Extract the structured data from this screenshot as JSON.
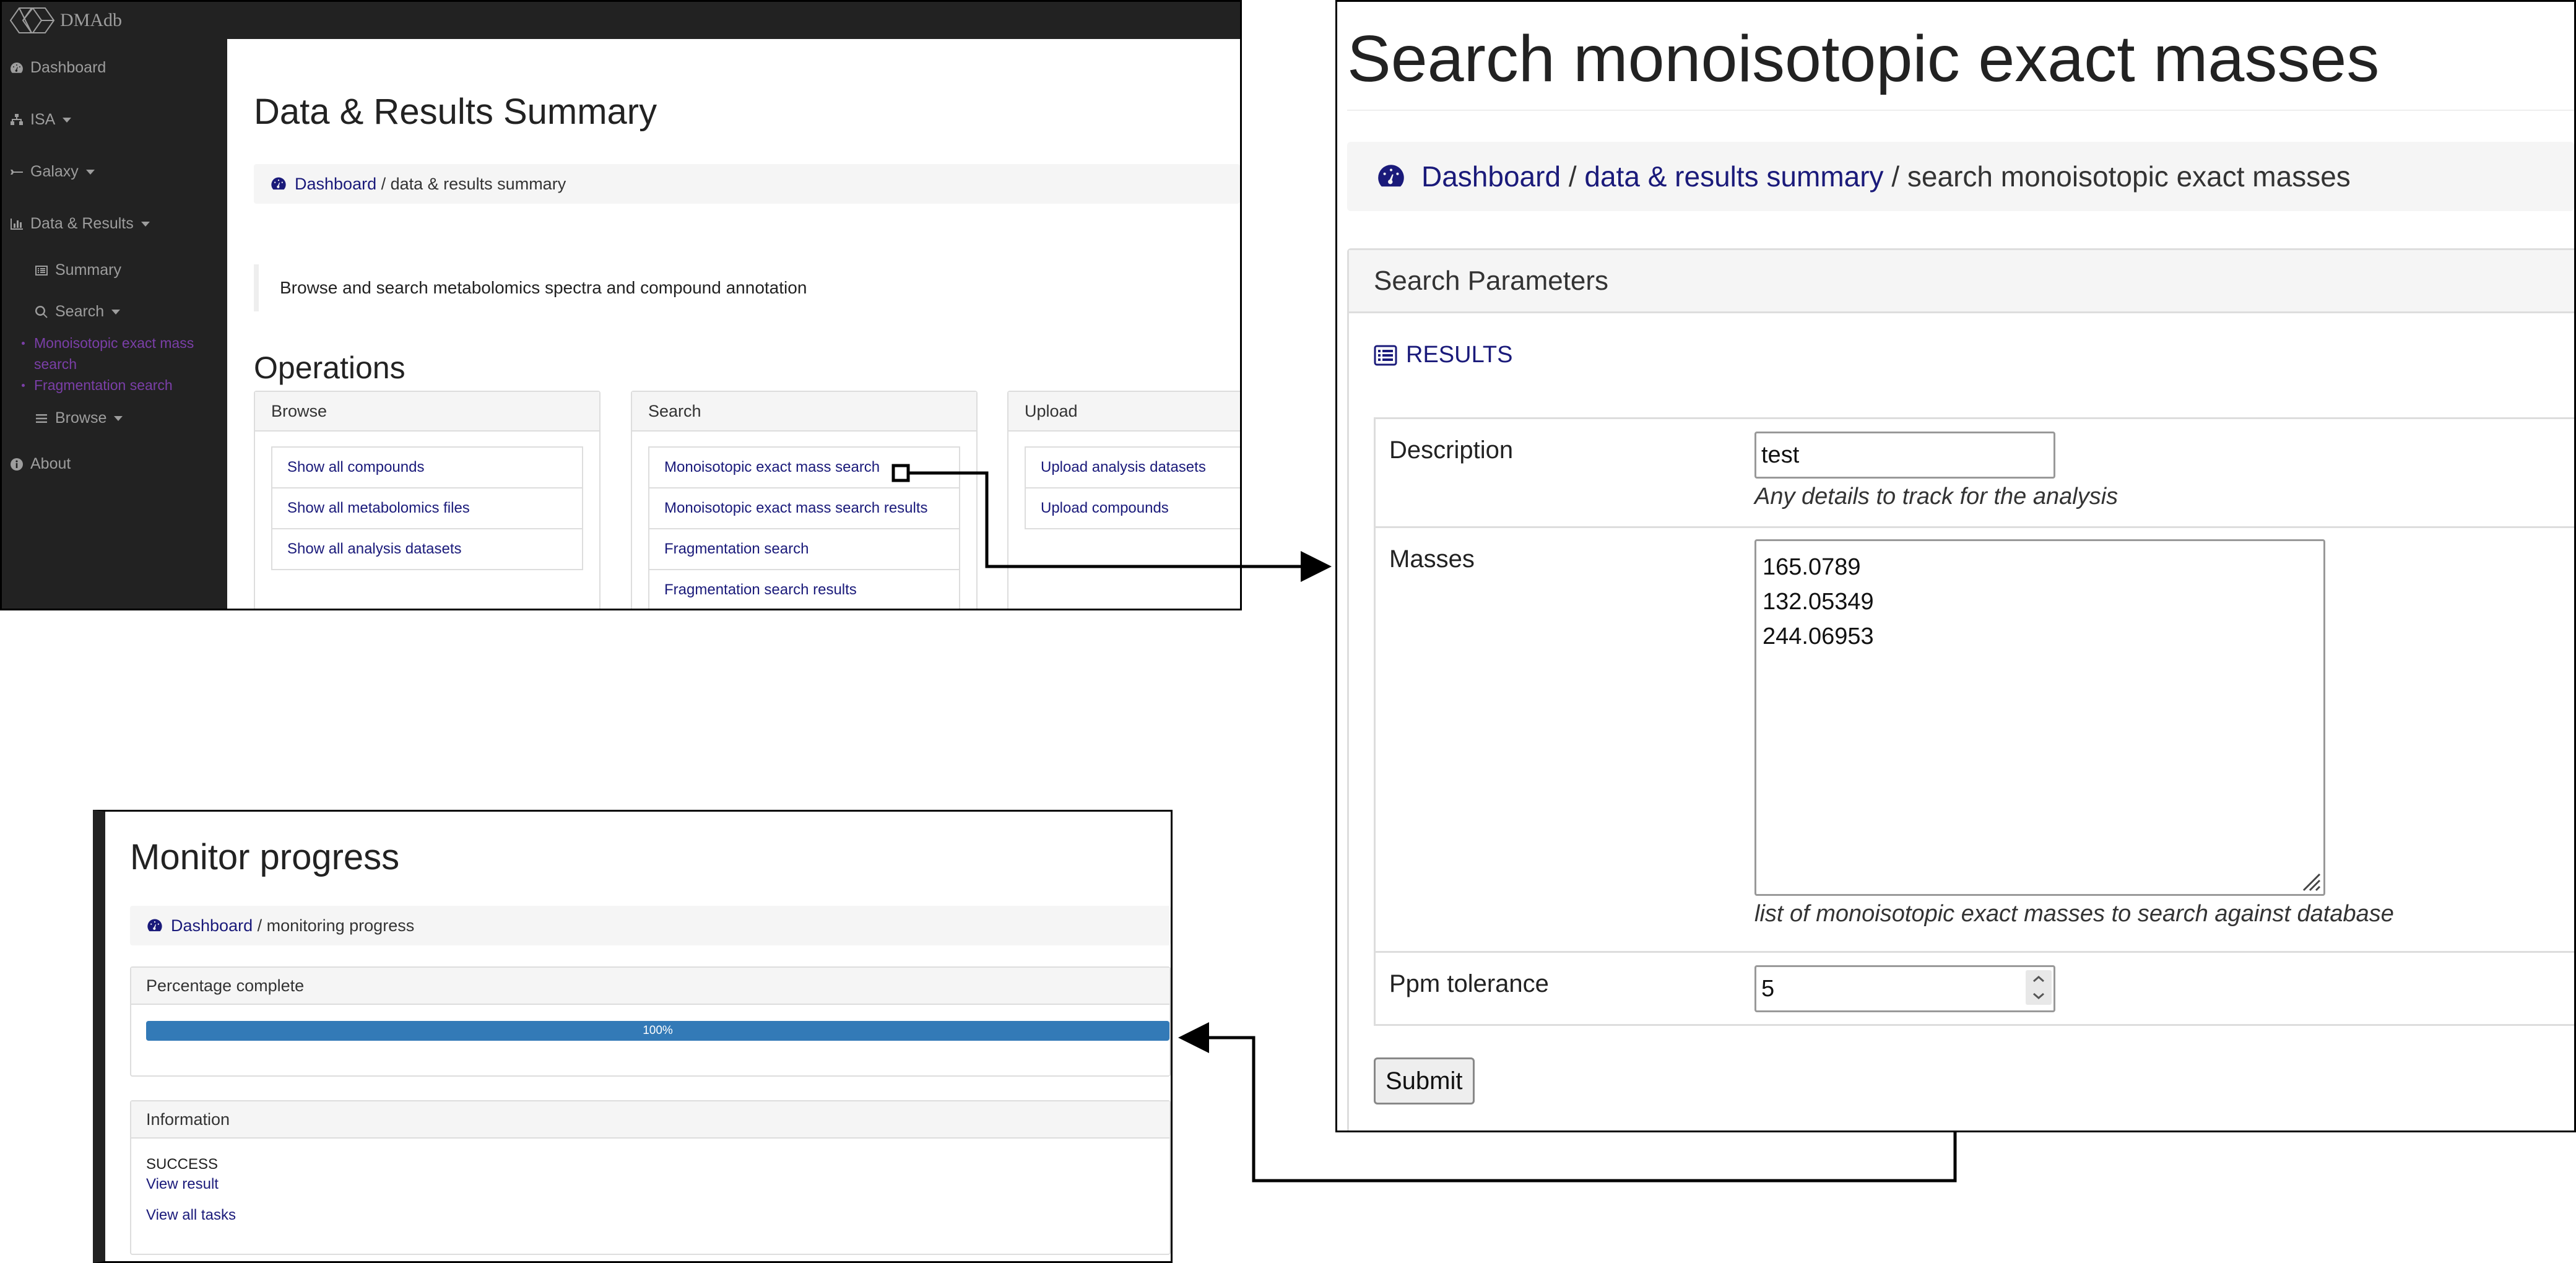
{
  "colors": {
    "navbar": "#222222",
    "sidebar_text": "#9d9d9d",
    "sidebar_active": "#7b3fa8",
    "link": "#1a1a7a",
    "progress": "#337ab7"
  },
  "summary": {
    "brand": "DMAdb",
    "sidebar": {
      "dashboard": "Dashboard",
      "isa": "ISA",
      "galaxy": "Galaxy",
      "data_results": "Data & Results",
      "summary": "Summary",
      "search": "Search",
      "mono_search": "Monoisotopic exact mass search",
      "frag_search": "Fragmentation search",
      "browse": "Browse",
      "about": "About"
    },
    "title": "Data & Results Summary",
    "breadcrumb": {
      "home": "Dashboard",
      "rest": " / data & results summary"
    },
    "intro": "Browse and search metabolomics spectra and compound annotation",
    "operations_title": "Operations",
    "cards": {
      "browse": {
        "title": "Browse",
        "items": [
          "Show all compounds",
          "Show all metabolomics files",
          "Show all analysis datasets"
        ]
      },
      "search": {
        "title": "Search",
        "items": [
          "Monoisotopic exact mass search",
          "Monoisotopic exact mass search results",
          "Fragmentation search",
          "Fragmentation search results"
        ]
      },
      "upload": {
        "title": "Upload",
        "items": [
          "Upload analysis datasets",
          "Upload compounds"
        ]
      }
    }
  },
  "search_page": {
    "title": "Search monoisotopic exact masses",
    "breadcrumb": {
      "home": "Dashboard",
      "sep1": " / ",
      "mid": "data & results summary",
      "rest": " / search monoisotopic exact masses"
    },
    "panel_title": "Search Parameters",
    "results_link": "RESULTS",
    "description": {
      "label": "Description",
      "value": "test",
      "help": "Any details to track for the analysis"
    },
    "masses": {
      "label": "Masses",
      "lines": [
        "165.0789",
        "132.05349",
        "244.06953"
      ],
      "help": "list of monoisotopic exact masses to search against database"
    },
    "ppm": {
      "label": "Ppm tolerance",
      "value": "5"
    },
    "submit": "Submit"
  },
  "monitor": {
    "title": "Monitor progress",
    "breadcrumb": {
      "home": "Dashboard",
      "rest": " / monitoring progress"
    },
    "percentage_title": "Percentage complete",
    "progress": {
      "percent": 100,
      "label": "100%"
    },
    "info_title": "Information",
    "status": "SUCCESS",
    "view_result": "View result",
    "view_all_tasks": "View all tasks"
  }
}
